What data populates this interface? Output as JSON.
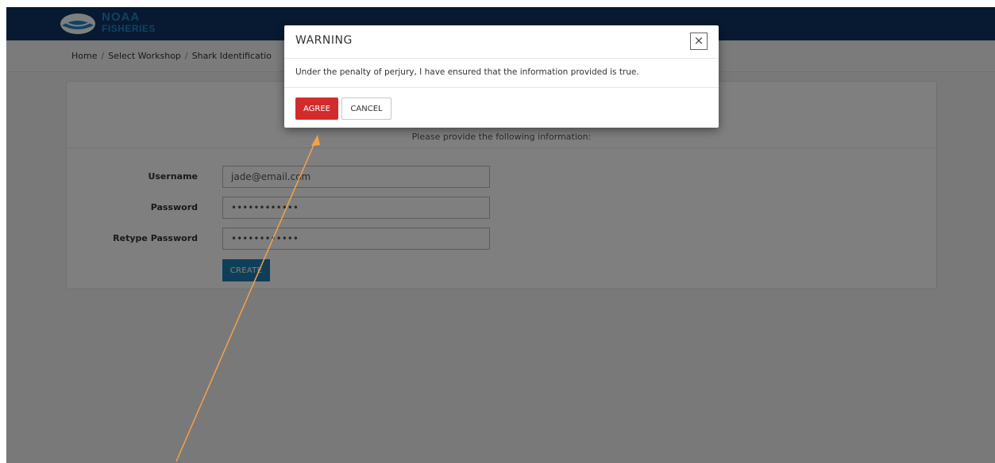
{
  "header": {
    "logo_top": "NOAA",
    "logo_bottom": "FISHERIES",
    "background": "#0f3562"
  },
  "breadcrumb": {
    "items": [
      "Home",
      "Select Workshop",
      "Shark Identificatio"
    ]
  },
  "form": {
    "instruction": "Please provide the following information:",
    "username_label": "Username",
    "username_value": "jade@email.com",
    "password_label": "Password",
    "password_value": "••••••••••••",
    "retype_label": "Retype Password",
    "retype_value": "••••••••••••",
    "create_label": "CREATE"
  },
  "modal": {
    "title": "WARNING",
    "close_glyph": "×",
    "message": "Under the penalty of perjury, I have ensured that the information provided is true.",
    "agree_label": "AGREE",
    "cancel_label": "CANCEL"
  },
  "colors": {
    "accent_blue": "#1e7fb0",
    "danger_red": "#d22b2b",
    "annotation_arrow": "#f5a04a"
  }
}
